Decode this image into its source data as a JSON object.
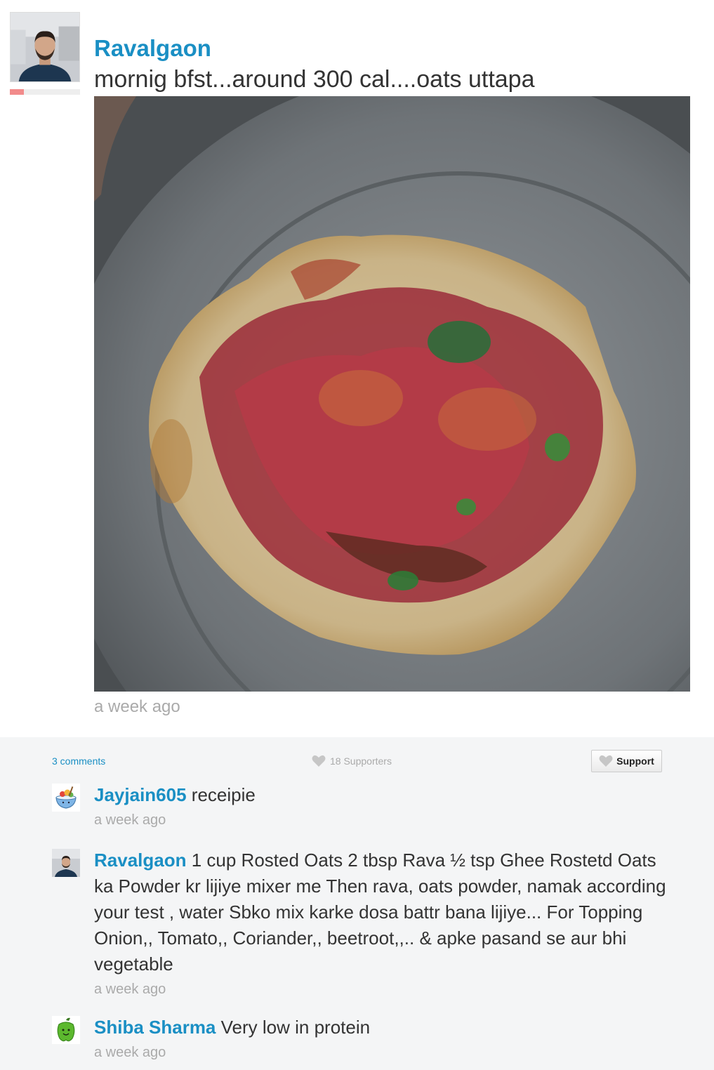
{
  "post": {
    "author": "Ravalgaon",
    "text": "mornig bfst...around 300 cal....oats uttapa",
    "time": "a week ago",
    "level_progress": 0.2,
    "level_color": "#f28b8b",
    "link_color": "#1a8fc4"
  },
  "bar": {
    "comment_count": "3 comments",
    "supporters": "18 Supporters",
    "support_label": "Support",
    "heart_icon": "heart-icon"
  },
  "comments": [
    {
      "author": "Jayjain605",
      "text": "receipie",
      "time": "a week ago",
      "avatar_icon": "food-bowl-icon"
    },
    {
      "author": "Ravalgaon",
      "text": "1 cup Rosted Oats 2 tbsp Rava ½ tsp Ghee Rostetd Oats ka Powder kr lijiye mixer me Then rava, oats powder, namak according your test , water Sbko mix karke dosa battr bana lijiye... For Topping Onion,, Tomato,, Coriander,, beetroot,,.. & apke pasand se aur bhi vegetable",
      "time": "a week ago",
      "avatar_icon": "user-photo-icon"
    },
    {
      "author": "Shiba Sharma",
      "text": "Very low in protein",
      "time": "a week ago",
      "avatar_icon": "green-pepper-icon"
    }
  ]
}
